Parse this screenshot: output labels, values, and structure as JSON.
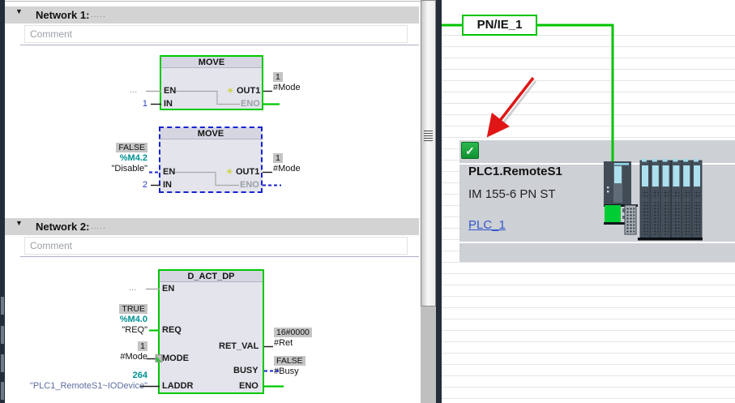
{
  "editor": {
    "networks": [
      {
        "label": "Network 1:",
        "dots": ".....",
        "comment": "Comment"
      },
      {
        "label": "Network 2:",
        "dots": ".....",
        "comment": "Comment"
      }
    ],
    "move1": {
      "title": "MOVE",
      "pin_en": "EN",
      "pin_in": "IN",
      "pin_out1": "OUT1",
      "pin_eno": "ENO",
      "en_value": "...",
      "in_value": "1",
      "out1_badge": "1",
      "out1_tag": "#Mode"
    },
    "move2": {
      "title": "MOVE",
      "pin_en": "EN",
      "pin_in": "IN",
      "pin_out1": "OUT1",
      "pin_eno": "ENO",
      "en_badge": "FALSE",
      "en_address": "%M4.2",
      "en_name": "\"Disable\"",
      "in_value": "2",
      "out1_badge": "1",
      "out1_tag": "#Mode"
    },
    "dact": {
      "title": "D_ACT_DP",
      "pin_en": "EN",
      "pin_req": "REQ",
      "pin_mode": "MODE",
      "pin_laddr": "LADDR",
      "pin_retval": "RET_VAL",
      "pin_busy": "BUSY",
      "pin_eno": "ENO",
      "en_value": "...",
      "req_badge": "TRUE",
      "req_address": "%M4.0",
      "req_name": "\"REQ\"",
      "mode_badge": "1",
      "mode_tag": "#Mode",
      "laddr_address": "264",
      "laddr_name": "\"PLC1_RemoteS1~IODevice\"",
      "retval_badge": "16#0000",
      "retval_tag": "#Ret",
      "busy_badge": "FALSE",
      "busy_tag": "#Busy"
    }
  },
  "network_view": {
    "subnet_label": "PN/IE_1",
    "device": {
      "name": "PLC1.RemoteS1",
      "type": "IM 155-6 PN ST",
      "controller_link": "PLC_1",
      "status_icon": "green-checkmark"
    }
  },
  "colors": {
    "active_green": "#00c800",
    "inactive_blue": "#1822cf",
    "address_teal": "#009193",
    "link_blue": "#3355cc",
    "status_green": "#12a337",
    "arrow_red": "#e01616"
  }
}
